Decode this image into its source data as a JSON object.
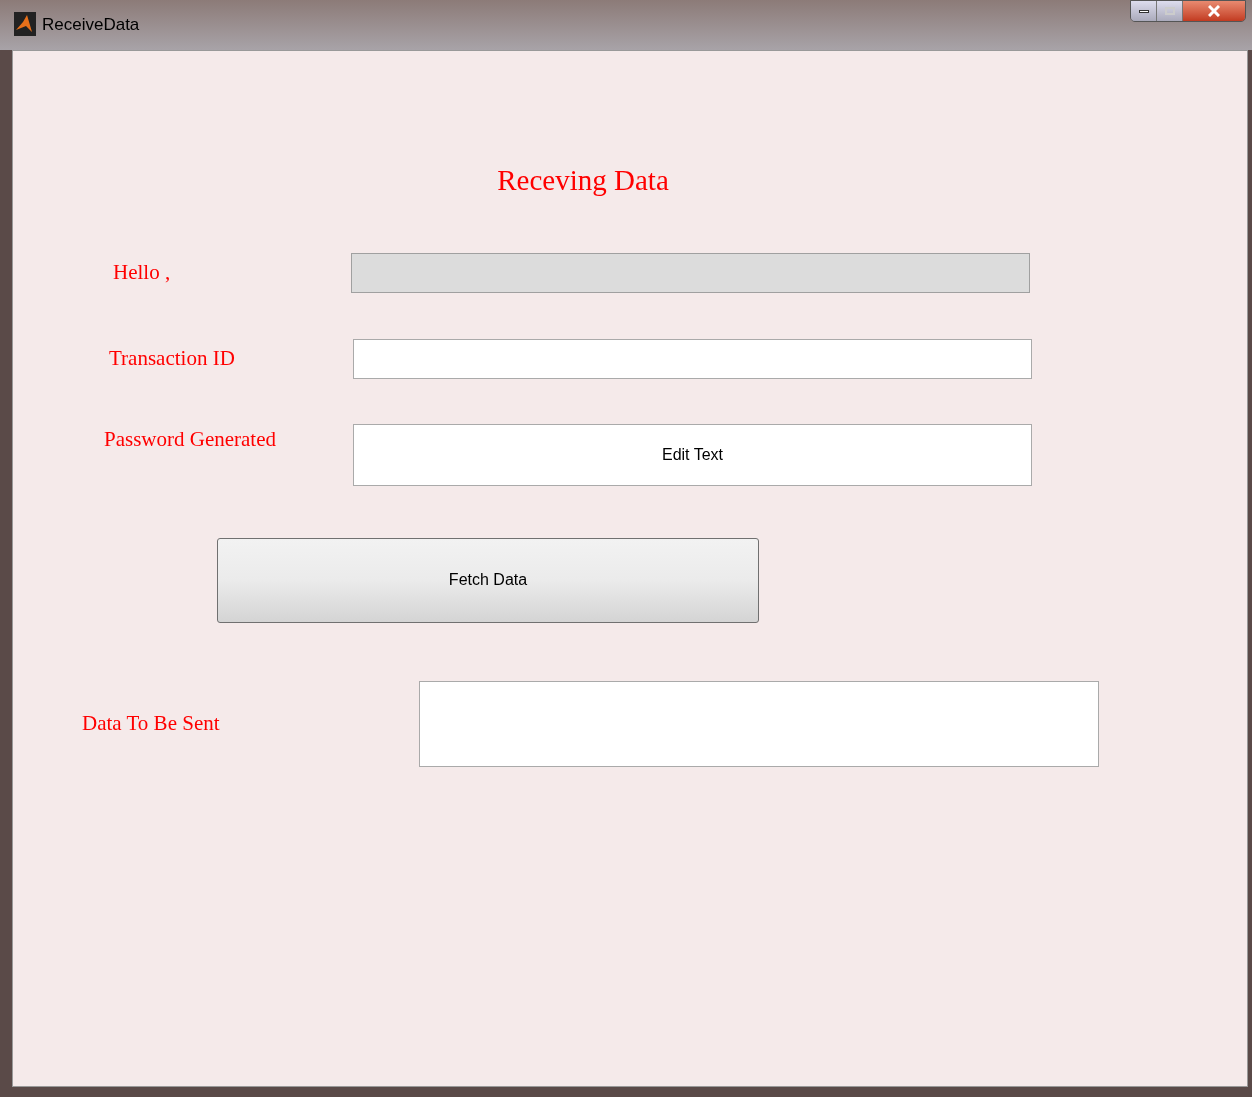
{
  "window": {
    "title": "ReceiveData"
  },
  "heading": "Receving Data",
  "fields": [
    {
      "label": "Hello ,",
      "disabled": true
    },
    {
      "label": "Transaction ID",
      "disabled": false
    },
    {
      "label": "Password Generated",
      "disabled": false,
      "value": "Edit Text"
    }
  ],
  "button": "Fetch Data",
  "output": {
    "label": "Data To Be Sent"
  }
}
